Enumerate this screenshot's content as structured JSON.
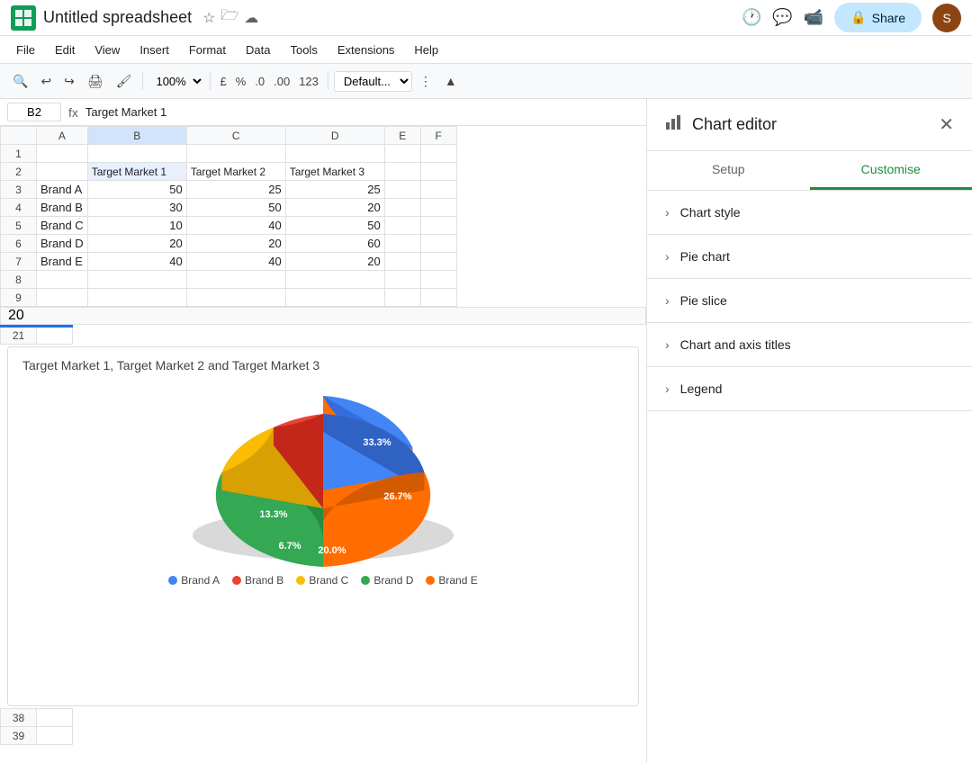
{
  "app": {
    "icon_color": "#0f9d58",
    "title": "Untitled spreadsheet",
    "avatar_letter": "S"
  },
  "top_bar": {
    "share_label": "Share",
    "history_icon": "⏱",
    "chat_icon": "💬",
    "video_icon": "📹"
  },
  "menu": {
    "items": [
      "File",
      "Edit",
      "View",
      "Insert",
      "Format",
      "Data",
      "Tools",
      "Extensions",
      "Help"
    ]
  },
  "toolbar": {
    "zoom": "100%",
    "currency": "£",
    "percent": "%",
    "decimal_dec": ".0",
    "decimal_inc": ".00",
    "format_123": "123",
    "font": "Defaul..."
  },
  "formula_bar": {
    "cell_ref": "B2",
    "formula_icon": "fx",
    "formula_value": "Target Market 1"
  },
  "spreadsheet": {
    "col_headers": [
      "",
      "A",
      "B",
      "C",
      "D",
      "E",
      "F"
    ],
    "rows": [
      {
        "num": 1,
        "cells": [
          "",
          "",
          "",
          "",
          "",
          "",
          ""
        ]
      },
      {
        "num": 2,
        "cells": [
          "",
          "Target Market 1",
          "Target Market 2",
          "Target Market 3",
          "",
          "",
          ""
        ]
      },
      {
        "num": 3,
        "cells": [
          "Brand A",
          "50",
          "25",
          "25",
          "",
          "",
          ""
        ]
      },
      {
        "num": 4,
        "cells": [
          "Brand B",
          "30",
          "50",
          "20",
          "",
          "",
          ""
        ]
      },
      {
        "num": 5,
        "cells": [
          "Brand C",
          "10",
          "40",
          "50",
          "",
          "",
          ""
        ]
      },
      {
        "num": 6,
        "cells": [
          "Brand D",
          "20",
          "20",
          "60",
          "",
          "",
          ""
        ]
      },
      {
        "num": 7,
        "cells": [
          "Brand E",
          "40",
          "40",
          "20",
          "",
          "",
          ""
        ]
      },
      {
        "num": 8,
        "cells": [
          "",
          "",
          "",
          "",
          "",
          "",
          ""
        ]
      },
      {
        "num": 9,
        "cells": [
          "",
          "",
          "",
          "",
          "",
          "",
          ""
        ]
      }
    ],
    "collapsed_rows": "20",
    "chart_rows_start": 21
  },
  "chart": {
    "title": "Target Market 1, Target Market 2 and Target Market 3",
    "slices": [
      {
        "label": "Brand A",
        "percent": "33.3%",
        "color": "#4285f4",
        "value": 33.3
      },
      {
        "label": "Brand B",
        "percent": "20.0%",
        "color": "#ea4335",
        "value": 20.0
      },
      {
        "label": "Brand C",
        "percent": "6.7%",
        "color": "#fbbc04",
        "value": 6.7
      },
      {
        "label": "Brand D",
        "percent": "13.3%",
        "color": "#34a853",
        "value": 13.3
      },
      {
        "label": "Brand E",
        "percent": "26.7%",
        "color": "#ff6d00",
        "value": 26.7
      }
    ],
    "legend": [
      "Brand A",
      "Brand B",
      "Brand C",
      "Brand D",
      "Brand E"
    ]
  },
  "chart_editor": {
    "title": "Chart editor",
    "icon": "📊",
    "tabs": [
      "Setup",
      "Customise"
    ],
    "active_tab": "Customise",
    "sections": [
      {
        "key": "chart_style",
        "label": "Chart style"
      },
      {
        "key": "pie_chart",
        "label": "Pie chart"
      },
      {
        "key": "pie_slice",
        "label": "Pie slice"
      },
      {
        "key": "chart_axis_titles",
        "label": "Chart and axis titles"
      },
      {
        "key": "legend",
        "label": "Legend"
      }
    ]
  }
}
